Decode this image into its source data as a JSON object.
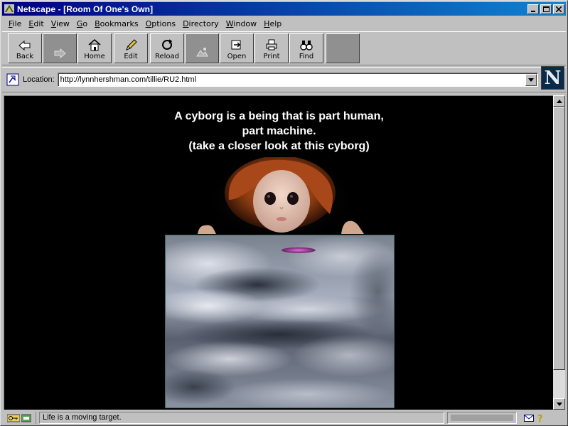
{
  "window": {
    "title": "Netscape - [Room Of One's Own]"
  },
  "menu": [
    {
      "pre": "",
      "u": "F",
      "post": "ile"
    },
    {
      "pre": "",
      "u": "E",
      "post": "dit"
    },
    {
      "pre": "",
      "u": "V",
      "post": "iew"
    },
    {
      "pre": "",
      "u": "G",
      "post": "o"
    },
    {
      "pre": "",
      "u": "B",
      "post": "ookmarks"
    },
    {
      "pre": "",
      "u": "O",
      "post": "ptions"
    },
    {
      "pre": "",
      "u": "D",
      "post": "irectory"
    },
    {
      "pre": "",
      "u": "W",
      "post": "indow"
    },
    {
      "pre": "",
      "u": "H",
      "post": "elp"
    }
  ],
  "toolbar": {
    "back": "Back",
    "forward": "",
    "home": "Home",
    "edit": "Edit",
    "reload": "Reload",
    "images": "",
    "open": "Open",
    "print": "Print",
    "find": "Find",
    "stop": ""
  },
  "location": {
    "label": "Location:",
    "url": "http://lynnhershman.com/tillie/RU2.html"
  },
  "logo": "N",
  "page": {
    "line1": "A cyborg is a being that is part human,",
    "line2": "part machine.",
    "line3": "(take a closer look at this cyborg)"
  },
  "status": {
    "text": "Life is a moving target."
  },
  "colors": {
    "titlebar_start": "#000080",
    "titlebar_end": "#1084d0",
    "content_bg": "#000000",
    "headline": "#ffffff"
  }
}
